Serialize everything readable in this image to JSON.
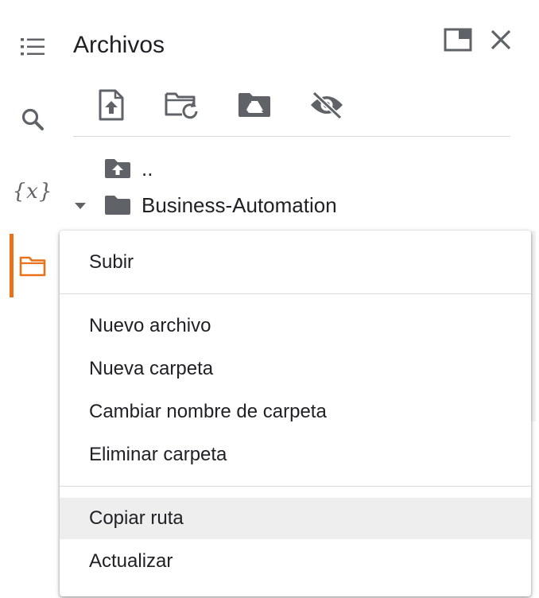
{
  "panel": {
    "title": "Archivos"
  },
  "rail": {
    "items": [
      {
        "name": "toc",
        "icon": "list-icon"
      },
      {
        "name": "search",
        "icon": "search-icon"
      },
      {
        "name": "variables",
        "icon": "variables-icon",
        "glyph": "{x}"
      },
      {
        "name": "files",
        "icon": "folder-icon",
        "active": true
      }
    ],
    "accent_color": "#e8711a"
  },
  "header_actions": [
    {
      "name": "open-in-tab",
      "icon": "window-icon"
    },
    {
      "name": "close",
      "icon": "close-icon"
    }
  ],
  "toolbar": [
    {
      "name": "upload",
      "icon": "file-upload-icon"
    },
    {
      "name": "refresh",
      "icon": "folder-refresh-icon"
    },
    {
      "name": "mount-drive",
      "icon": "drive-folder-icon"
    },
    {
      "name": "toggle-hidden",
      "icon": "eye-off-icon"
    }
  ],
  "tree": {
    "parent_label": "..",
    "folder_label": "Business-Automation"
  },
  "context_menu": {
    "items": [
      {
        "label": "Subir"
      },
      {
        "label": "Nuevo archivo"
      },
      {
        "label": "Nueva carpeta"
      },
      {
        "label": "Cambiar nombre de carpeta"
      },
      {
        "label": "Eliminar carpeta"
      },
      {
        "label": "Copiar ruta",
        "hovered": true
      },
      {
        "label": "Actualizar"
      }
    ]
  }
}
